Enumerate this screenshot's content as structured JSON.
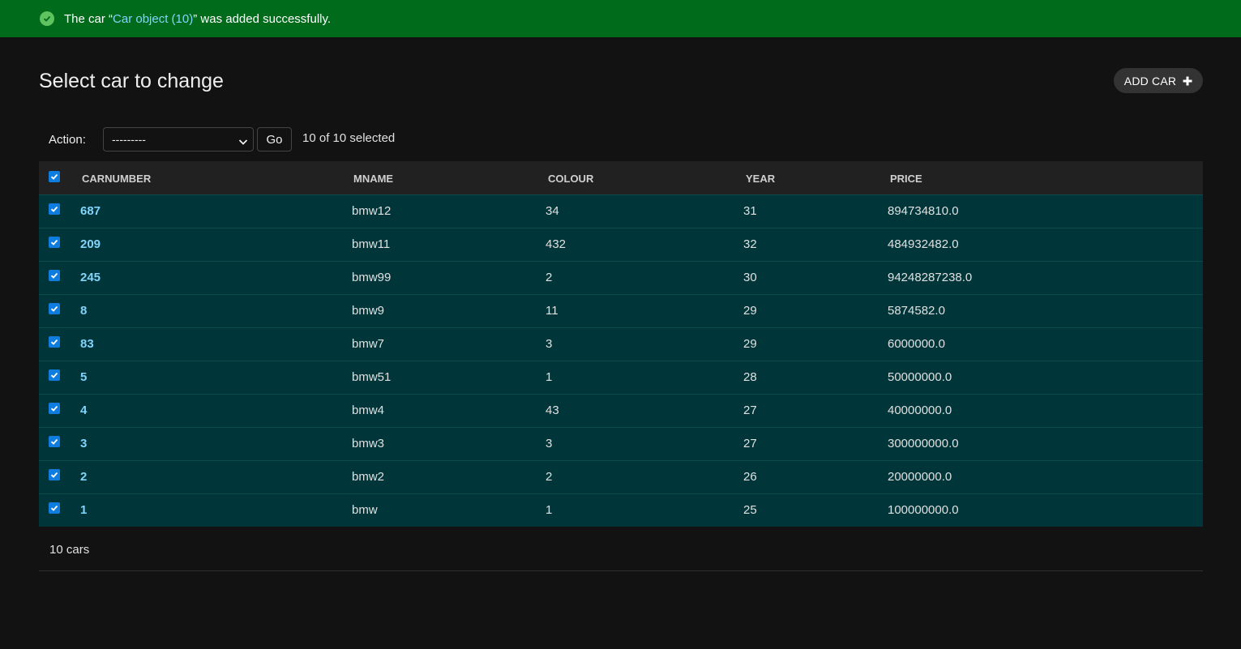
{
  "messages": {
    "success_prefix": "The car “",
    "success_link": "Car object (10)",
    "success_suffix": "” was added successfully."
  },
  "header": {
    "title": "Select car to change",
    "add_button_label": "ADD CAR"
  },
  "actions": {
    "label": "Action:",
    "select_value": "---------",
    "go_label": "Go",
    "selected_text": "10 of 10 selected"
  },
  "table": {
    "columns": [
      "CARNUMBER",
      "MNAME",
      "COLOUR",
      "YEAR",
      "PRICE"
    ],
    "rows": [
      {
        "carnumber": "687",
        "mname": "bmw12",
        "colour": "34",
        "year": "31",
        "price": "894734810.0"
      },
      {
        "carnumber": "209",
        "mname": "bmw11",
        "colour": "432",
        "year": "32",
        "price": "484932482.0"
      },
      {
        "carnumber": "245",
        "mname": "bmw99",
        "colour": "2",
        "year": "30",
        "price": "94248287238.0"
      },
      {
        "carnumber": "8",
        "mname": "bmw9",
        "colour": "11",
        "year": "29",
        "price": "5874582.0"
      },
      {
        "carnumber": "83",
        "mname": "bmw7",
        "colour": "3",
        "year": "29",
        "price": "6000000.0"
      },
      {
        "carnumber": "5",
        "mname": "bmw51",
        "colour": "1",
        "year": "28",
        "price": "50000000.0"
      },
      {
        "carnumber": "4",
        "mname": "bmw4",
        "colour": "43",
        "year": "27",
        "price": "40000000.0"
      },
      {
        "carnumber": "3",
        "mname": "bmw3",
        "colour": "3",
        "year": "27",
        "price": "300000000.0"
      },
      {
        "carnumber": "2",
        "mname": "bmw2",
        "colour": "2",
        "year": "26",
        "price": "20000000.0"
      },
      {
        "carnumber": "1",
        "mname": "bmw",
        "colour": "1",
        "year": "25",
        "price": "100000000.0"
      }
    ]
  },
  "paginator": {
    "count_text": "10 cars"
  },
  "colors": {
    "success_bg": "#006b1b",
    "row_bg": "#00363a",
    "link": "#81d4fa",
    "checkbox": "#0f7de0"
  }
}
